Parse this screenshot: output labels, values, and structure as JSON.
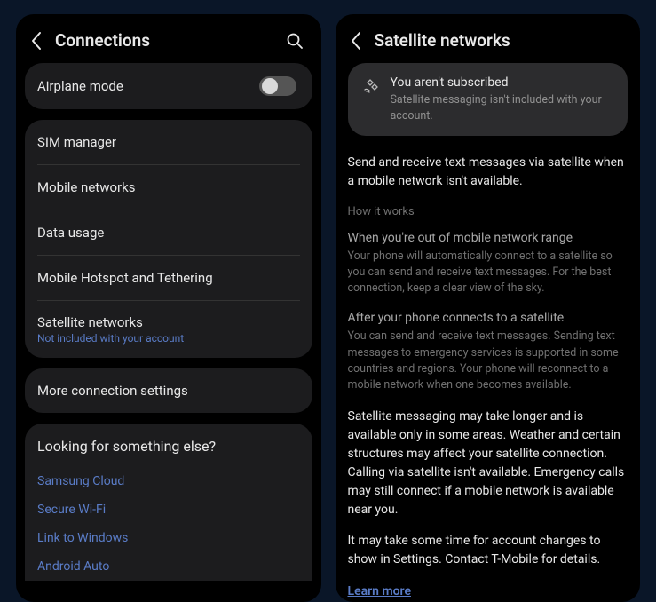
{
  "left": {
    "title": "Connections",
    "airplane": {
      "label": "Airplane mode",
      "on": false
    },
    "rows": {
      "sim": "SIM manager",
      "mobile": "Mobile networks",
      "data": "Data usage",
      "hotspot": "Mobile Hotspot and Tethering",
      "satellite": {
        "label": "Satellite networks",
        "sublabel": "Not included with your account"
      }
    },
    "more": "More connection settings",
    "footer": {
      "title": "Looking for something else?",
      "links": {
        "cloud": "Samsung Cloud",
        "wifi": "Secure Wi-Fi",
        "windows": "Link to Windows",
        "auto": "Android Auto"
      }
    }
  },
  "right": {
    "title": "Satellite networks",
    "notice": {
      "title": "You aren't subscribed",
      "text": "Satellite messaging isn't included with your account."
    },
    "intro": "Send and receive text messages via satellite when a mobile network isn't available.",
    "how_label": "How it works",
    "block1": {
      "heading": "When you're out of mobile network range",
      "body": "Your phone will automatically connect to a satellite so you can send and receive text messages. For the best connection, keep a clear view of the sky."
    },
    "block2": {
      "heading": "After your phone connects to a satellite",
      "body": "You can send and receive text messages. Sending text messages to emergency services is supported in some countries and regions. Your phone will reconnect to a mobile network when one becomes available."
    },
    "warn1": "Satellite messaging may take longer and is available only in some areas. Weather and certain structures may affect your satellite connection. Calling via satellite isn't available. Emergency calls may still connect if a mobile network is available near you.",
    "warn2": "It may take some time for account changes to show in Settings. Contact T-Mobile for details.",
    "learn": "Learn more"
  }
}
